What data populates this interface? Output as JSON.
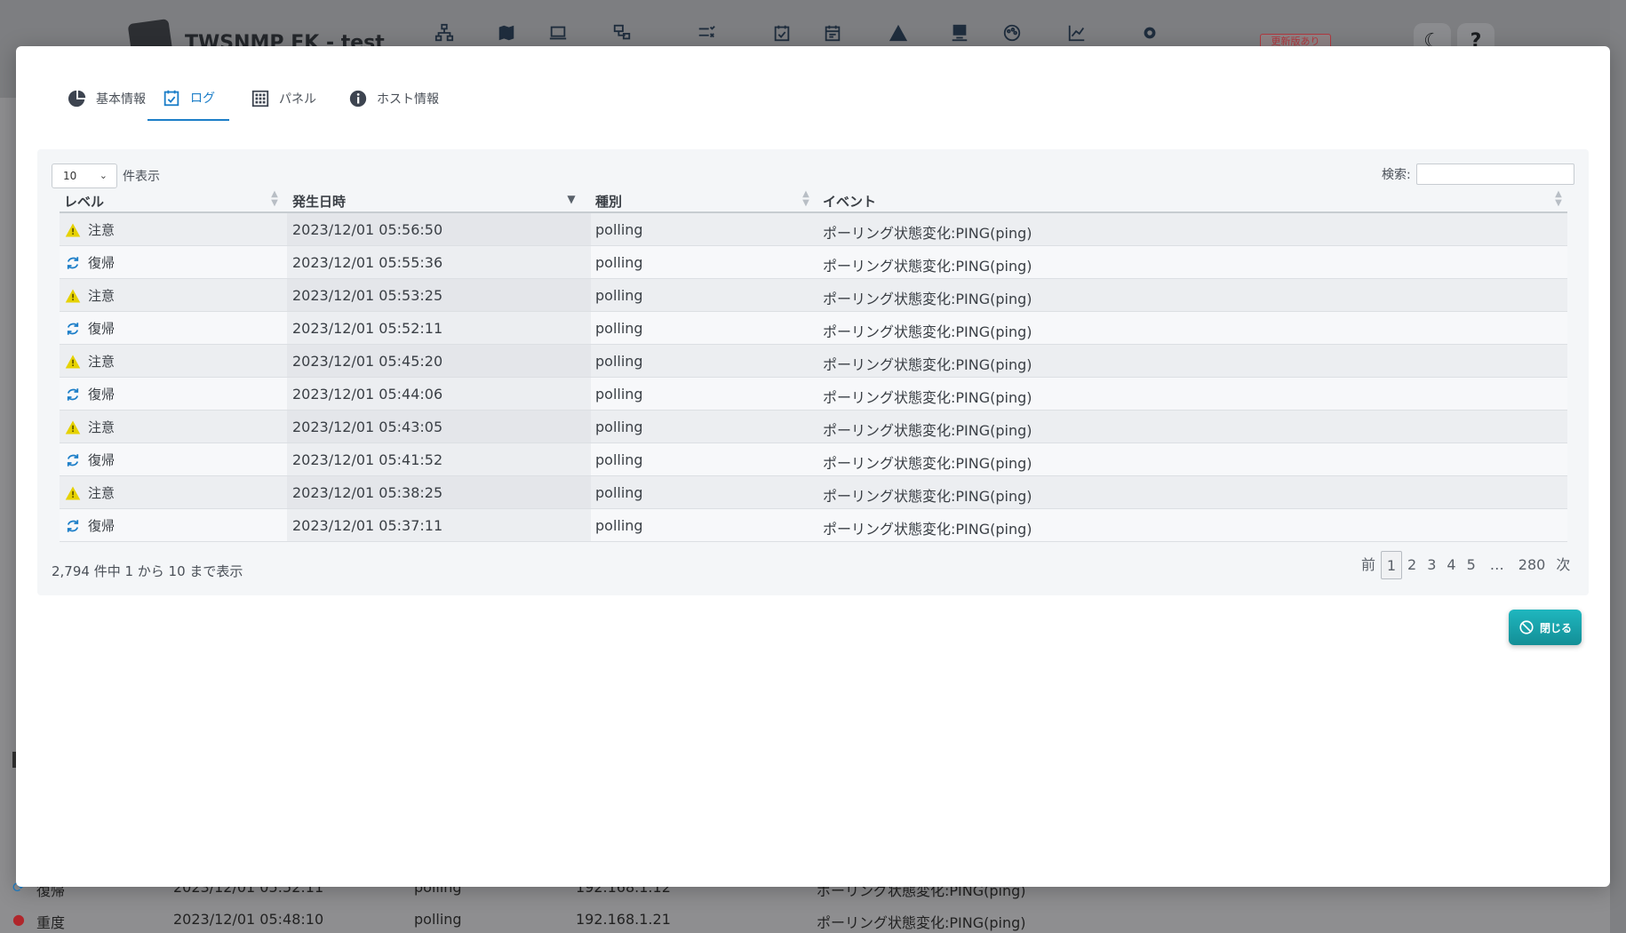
{
  "app": {
    "title": "TWSNMP FK - test",
    "update_badge": "更新版あり",
    "header_icons": [
      "network-map-icon",
      "map-icon",
      "laptop-icon",
      "device-network-icon",
      "checklist-icon",
      "calendar-check-icon",
      "calendar-icon",
      "warning-icon",
      "monitor-check-icon",
      "palette-icon",
      "chart-line-icon",
      "gear-icon"
    ],
    "moon_icon": "☾",
    "help_icon": "?"
  },
  "background_rows": [
    {
      "level": "復帰",
      "time": "2023/12/01 05:52:11",
      "type": "polling",
      "ip": "192.168.1.12",
      "event": "ポーリング状態変化:PING(ping)"
    },
    {
      "level": "重度",
      "time": "2023/12/01 05:48:10",
      "type": "polling",
      "ip": "192.168.1.21",
      "event": "ポーリング状態変化:PING(ping)"
    }
  ],
  "modal": {
    "tabs": [
      {
        "label": "基本情報",
        "icon": "pie-chart-icon"
      },
      {
        "label": "ログ",
        "icon": "calendar-check-icon"
      },
      {
        "label": "パネル",
        "icon": "grid-icon"
      },
      {
        "label": "ホスト情報",
        "icon": "info-icon"
      }
    ],
    "active_tab": 1,
    "length_select": {
      "value": "10",
      "suffix": "件表示"
    },
    "search": {
      "label": "検索:",
      "value": ""
    },
    "columns": [
      "レベル",
      "発生日時",
      "種別",
      "イベント"
    ],
    "rows": [
      {
        "level": "注意",
        "level_kind": "warn",
        "time": "2023/12/01 05:56:50",
        "type": "polling",
        "event": "ポーリング状態変化:PING(ping)"
      },
      {
        "level": "復帰",
        "level_kind": "repair",
        "time": "2023/12/01 05:55:36",
        "type": "polling",
        "event": "ポーリング状態変化:PING(ping)"
      },
      {
        "level": "注意",
        "level_kind": "warn",
        "time": "2023/12/01 05:53:25",
        "type": "polling",
        "event": "ポーリング状態変化:PING(ping)"
      },
      {
        "level": "復帰",
        "level_kind": "repair",
        "time": "2023/12/01 05:52:11",
        "type": "polling",
        "event": "ポーリング状態変化:PING(ping)"
      },
      {
        "level": "注意",
        "level_kind": "warn",
        "time": "2023/12/01 05:45:20",
        "type": "polling",
        "event": "ポーリング状態変化:PING(ping)"
      },
      {
        "level": "復帰",
        "level_kind": "repair",
        "time": "2023/12/01 05:44:06",
        "type": "polling",
        "event": "ポーリング状態変化:PING(ping)"
      },
      {
        "level": "注意",
        "level_kind": "warn",
        "time": "2023/12/01 05:43:05",
        "type": "polling",
        "event": "ポーリング状態変化:PING(ping)"
      },
      {
        "level": "復帰",
        "level_kind": "repair",
        "time": "2023/12/01 05:41:52",
        "type": "polling",
        "event": "ポーリング状態変化:PING(ping)"
      },
      {
        "level": "注意",
        "level_kind": "warn",
        "time": "2023/12/01 05:38:25",
        "type": "polling",
        "event": "ポーリング状態変化:PING(ping)"
      },
      {
        "level": "復帰",
        "level_kind": "repair",
        "time": "2023/12/01 05:37:11",
        "type": "polling",
        "event": "ポーリング状態変化:PING(ping)"
      }
    ],
    "info_text": "2,794 件中 1 から 10 まで表示",
    "pagination": {
      "prev": "前",
      "pages": [
        "1",
        "2",
        "3",
        "4",
        "5"
      ],
      "ellipsis": "…",
      "last": "280",
      "next": "次",
      "current": "1"
    },
    "close_button": "閉じる"
  },
  "colors": {
    "accent": "#1c7ec8",
    "warn": "#e6d200",
    "repair": "#1c7ec8",
    "danger": "#c62828",
    "close_button": "#17a2a9"
  }
}
